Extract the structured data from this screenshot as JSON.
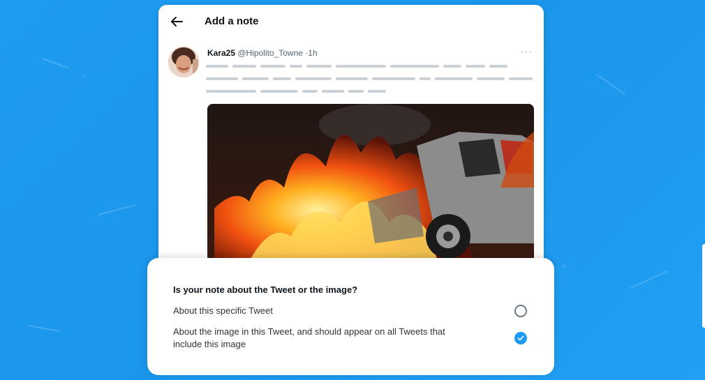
{
  "header": {
    "title": "Add a note"
  },
  "tweet": {
    "display_name": "Kara25",
    "handle": "@Hipolito_Towne",
    "separator": "·",
    "time": "1h",
    "more_label": "···"
  },
  "note_dialog": {
    "question": "Is your note about the Tweet or the image?",
    "options": [
      {
        "label": "About this specific Tweet",
        "selected": false
      },
      {
        "label": "About the image in this Tweet, and should appear on all Tweets that include this image",
        "selected": true
      }
    ]
  },
  "colors": {
    "accent": "#1d9bf0",
    "background": "#1d9bf0",
    "text_primary": "#0f1419",
    "text_secondary": "#536471"
  },
  "icons": {
    "back": "back-arrow-icon",
    "more": "more-icon",
    "check": "check-icon"
  }
}
